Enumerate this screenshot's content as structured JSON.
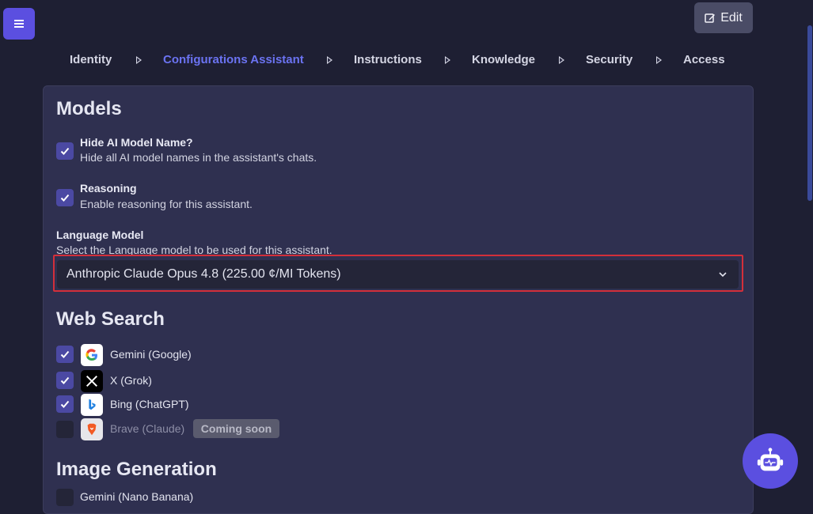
{
  "header": {
    "edit_label": "Edit"
  },
  "steps": [
    {
      "label": "Identity",
      "active": false
    },
    {
      "label": "Configurations Assistant",
      "active": true
    },
    {
      "label": "Instructions",
      "active": false
    },
    {
      "label": "Knowledge",
      "active": false
    },
    {
      "label": "Security",
      "active": false
    },
    {
      "label": "Access",
      "active": false
    }
  ],
  "models": {
    "title": "Models",
    "options": [
      {
        "title": "Hide AI Model Name?",
        "desc": "Hide all AI model names in the assistant's chats.",
        "checked": true
      },
      {
        "title": "Reasoning",
        "desc": "Enable reasoning for this assistant.",
        "checked": true
      }
    ],
    "language_model": {
      "label": "Language Model",
      "desc": "Select the Language model to be used for this assistant.",
      "selected": "Anthropic Claude Opus 4.8 (225.00 ¢/MI Tokens)"
    }
  },
  "web_search": {
    "title": "Web Search",
    "items": [
      {
        "label": "Gemini (Google)",
        "checked": true,
        "icon": "google-icon"
      },
      {
        "label": "X (Grok)",
        "checked": true,
        "icon": "x-icon"
      },
      {
        "label": "Bing (ChatGPT)",
        "checked": true,
        "icon": "bing-icon"
      },
      {
        "label": "Brave (Claude)",
        "checked": false,
        "icon": "brave-icon",
        "badge": "Coming soon"
      }
    ]
  },
  "image_generation": {
    "title": "Image Generation",
    "items": [
      {
        "label": "Gemini (Nano Banana)",
        "checked": false
      }
    ]
  },
  "colors": {
    "accent": "#5b4fe0",
    "active_step": "#6b73f2",
    "highlight_border": "#d32f3a"
  }
}
